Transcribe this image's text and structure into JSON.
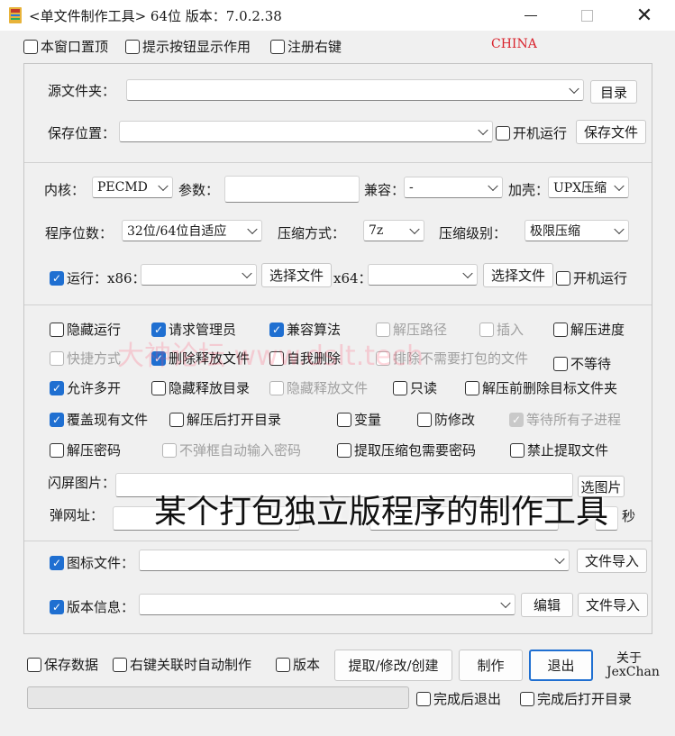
{
  "window": {
    "title": "<单文件制作工具> 64位 版本：7.0.2.38"
  },
  "top_options": {
    "stay_on_top": "本窗口置顶",
    "show_tips": "提示按钮显示作用",
    "register_menu": "注册右键",
    "brand": "CHINA"
  },
  "source": {
    "label": "源文件夹：",
    "dir_button": "目录"
  },
  "save": {
    "label": "保存位置：",
    "autostart": "开机运行",
    "save_button": "保存文件"
  },
  "kernel": {
    "label": "内核：",
    "value": "PECMD",
    "params_label": "参数：",
    "compat_label": "兼容：",
    "compat_value": "-",
    "shell_label": "加壳：",
    "shell_value": "UPX压缩"
  },
  "bits": {
    "label": "程序位数：",
    "value": "32位/64位自适应",
    "compress_label": "压缩方式：",
    "compress_value": "7z",
    "level_label": "压缩级别：",
    "level_value": "极限压缩"
  },
  "run": {
    "label": "运行：x86：",
    "choose_x86": "选择文件",
    "x64_label": "x64：",
    "choose_x64": "选择文件",
    "autostart": "开机运行"
  },
  "options": {
    "hidden_run": "隐藏运行",
    "request_admin": "请求管理员",
    "compat_algo": "兼容算法",
    "extract_path": "解压路径",
    "insert": "插入",
    "extract_progress": "解压进度",
    "shortcut": "快捷方式",
    "delete_released": "删除释放文件",
    "self_delete": "自我删除",
    "exclude_unneeded": "排除不需要打包的文件",
    "no_wait": "不等待",
    "allow_multi": "允许多开",
    "hide_release_dir": "隐藏释放目录",
    "hide_release_file": "隐藏释放文件",
    "readonly": "只读",
    "delete_target_before": "解压前删除目标文件夹",
    "overwrite": "覆盖现有文件",
    "open_dir_after": "解压后打开目录",
    "variable": "变量",
    "anti_modify": "防修改",
    "wait_children": "等待所有子进程",
    "extract_password": "解压密码",
    "no_popup_password": "不弹框自动输入密码",
    "extract_needs_password": "提取压缩包需要密码",
    "forbid_extract": "禁止提取文件"
  },
  "splash": {
    "label": "闪屏图片：",
    "choose": "选图片"
  },
  "popup": {
    "label": "弹网址：",
    "seconds": "秒"
  },
  "overlay": {
    "text": "某个打包独立版程序的制作工具",
    "watermark": "大神论坛 www.dslt.tech"
  },
  "icon_file": {
    "label": "图标文件：",
    "import": "文件导入"
  },
  "version_info": {
    "label": "版本信息：",
    "edit": "编辑",
    "import": "文件导入"
  },
  "bottom": {
    "save_data": "保存数据",
    "auto_make": "右键关联时自动制作",
    "version": "版本",
    "extract_modify": "提取/修改/创建",
    "make": "制作",
    "exit": "退出",
    "about": "关于",
    "author": "JexChan",
    "exit_after": "完成后退出",
    "open_after": "完成后打开目录"
  },
  "colors": {
    "accent": "#1f6fd1",
    "brand": "#d9232d"
  }
}
